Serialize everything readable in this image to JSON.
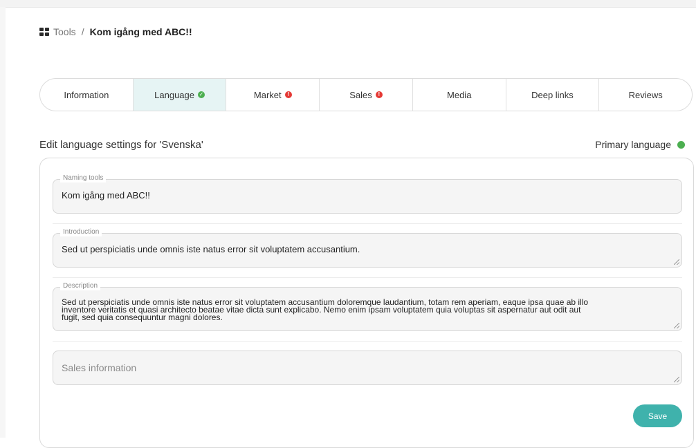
{
  "breadcrumb": {
    "icon": "grid-icon",
    "root": "Tools",
    "separator": "/",
    "current": "Kom igång med ABC!!"
  },
  "tabs": [
    {
      "label": "Information",
      "status": null,
      "active": false
    },
    {
      "label": "Language",
      "status": "ok",
      "active": true
    },
    {
      "label": "Market",
      "status": "warning",
      "active": false
    },
    {
      "label": "Sales",
      "status": "warning",
      "active": false
    },
    {
      "label": "Media",
      "status": null,
      "active": false
    },
    {
      "label": "Deep links",
      "status": null,
      "active": false
    },
    {
      "label": "Reviews",
      "status": null,
      "active": false
    }
  ],
  "status_glyphs": {
    "ok": "✓",
    "warning": "!"
  },
  "section": {
    "title": "Edit language settings for 'Svenska'",
    "primary_language_label": "Primary language",
    "primary_language_color": "#4caf50"
  },
  "form": {
    "naming_tools": {
      "label": "Naming tools",
      "value": "Kom igång med ABC!!"
    },
    "introduction": {
      "label": "Introduction",
      "value": "Sed ut perspiciatis unde omnis iste natus error sit voluptatem accusantium."
    },
    "description": {
      "label": "Description",
      "lines": [
        "Sed ut perspiciatis unde omnis iste natus error sit voluptatem accusantium doloremque laudantium, totam rem aperiam, eaque ipsa quae ab illo",
        "inventore veritatis et quasi architecto beatae vitae dicta sunt explicabo. Nemo enim ipsam voluptatem quia voluptas sit aspernatur aut odit aut",
        "fugit, sed quia consequuntur magni dolores."
      ]
    },
    "sales_information": {
      "placeholder": "Sales information"
    },
    "save_label": "Save"
  },
  "colors": {
    "accent": "#3fb2ac",
    "active_tab_bg": "#e6f4f4",
    "ok": "#4caf50",
    "warning": "#e53935"
  }
}
